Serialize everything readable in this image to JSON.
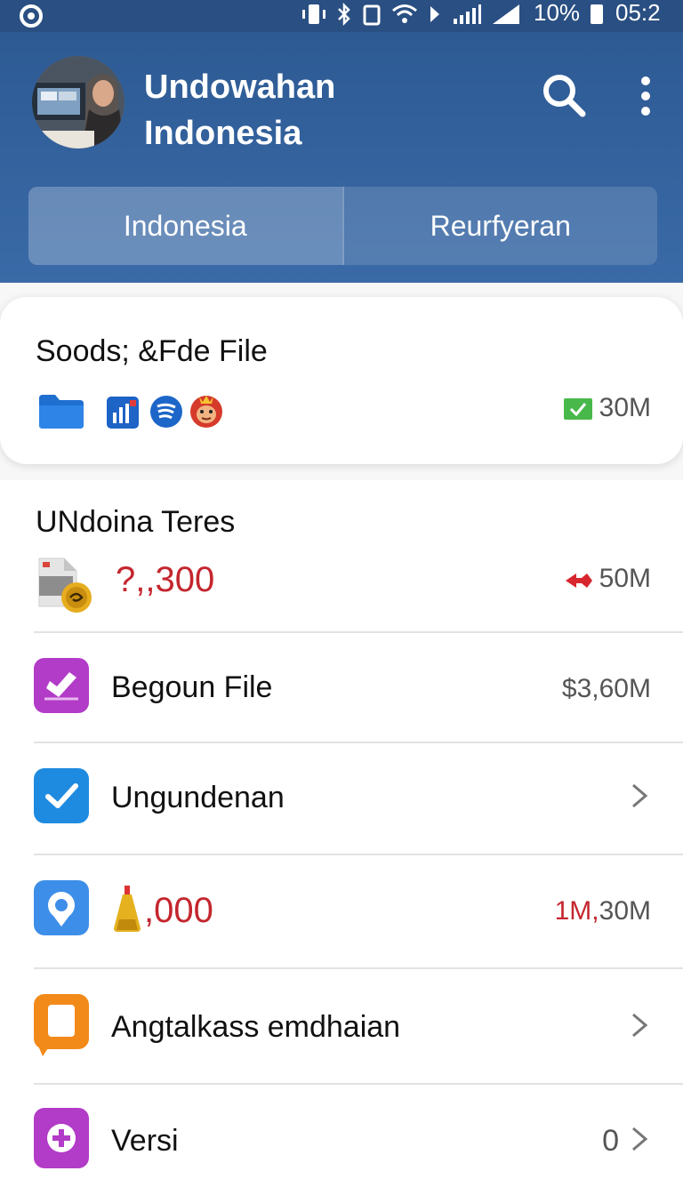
{
  "status_bar": {
    "battery": "10%",
    "time": "05:2"
  },
  "header": {
    "title_line1": "Undowahan",
    "title_line2": "Indonesia",
    "tabs": [
      {
        "label": "Indonesia",
        "active": true
      },
      {
        "label": "Reurfyeran",
        "active": false
      }
    ]
  },
  "card1": {
    "title": "Soods; &Fde File",
    "icons": [
      "folder-icon",
      "chart-icon",
      "spotify-icon",
      "monkey-icon"
    ],
    "status_icon": "check-mail-icon",
    "size": "30M"
  },
  "card2": {
    "title": "UNdoina Teres",
    "value": "?,,300",
    "size_icon": "red-arrow-icon",
    "size": "50M"
  },
  "rows": [
    {
      "icon": "edit-icon",
      "label": "Begoun File",
      "value": "$3,60M",
      "color": "#b23bc7"
    },
    {
      "icon": "check-icon",
      "label": "Ungundenan",
      "value": "",
      "color": "#1f8be0"
    },
    {
      "icon": "maps-icon",
      "label": ",000",
      "value_red": "1M,",
      "value": "30M",
      "color": "#3d8ee8"
    },
    {
      "icon": "message-icon",
      "label": "Angtalkass emdhaian",
      "value": "",
      "color": "#f28a1a"
    },
    {
      "icon": "plus-icon",
      "label": "Versi",
      "value": "0",
      "color": "#b23bc7"
    }
  ],
  "colors": {
    "header": "#2d5a93",
    "accent_red": "#c4262e"
  }
}
